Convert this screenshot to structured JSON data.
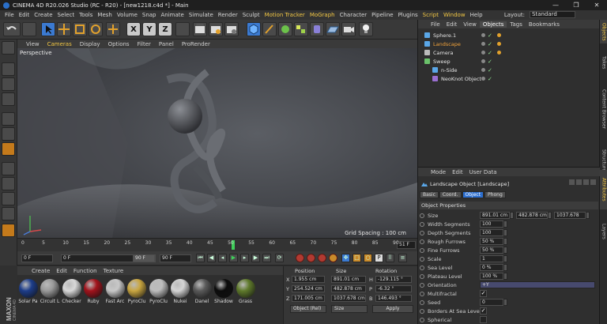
{
  "titlebar": {
    "title": "CINEMA 4D R20.026 Studio (RC - R20) - [new1218.c4d *] - Main",
    "minimize": "—",
    "maximize": "❐",
    "close": "✕"
  },
  "menubar": {
    "items": [
      "File",
      "Edit",
      "Create",
      "Select",
      "Tools",
      "Mesh",
      "Volume",
      "Snap",
      "Animate",
      "Simulate",
      "Render",
      "Sculpt",
      "Motion Tracker",
      "MoGraph",
      "Character",
      "Pipeline",
      "Plugins",
      "Script",
      "Window",
      "Help"
    ],
    "layout_label": "Layout:",
    "layout_value": "Standard"
  },
  "viewport": {
    "menu": [
      "View",
      "Cameras",
      "Display",
      "Options",
      "Filter",
      "Panel",
      "ProRender"
    ],
    "label": "Perspective",
    "grid_spacing": "Grid Spacing : 100 cm"
  },
  "timeline": {
    "ticks": [
      "0",
      "5",
      "10",
      "15",
      "20",
      "25",
      "30",
      "35",
      "40",
      "45",
      "50",
      "55",
      "60",
      "65",
      "70",
      "75",
      "80",
      "85",
      "90"
    ],
    "current_frame": 51,
    "frame_field": "51 F",
    "max_frame": 90
  },
  "transport": {
    "start": "0 F",
    "current": "0 F",
    "end_left": "90 F",
    "end_right": "90 F"
  },
  "material_manager": {
    "menu": [
      "Create",
      "Edit",
      "Function",
      "Texture"
    ],
    "materials": [
      {
        "name": "Solar Pa",
        "color": "#1d3d8a"
      },
      {
        "name": "Circuit L",
        "color": "#9a9a9a"
      },
      {
        "name": "Checker",
        "color": "#d8d8d8"
      },
      {
        "name": "Ruby",
        "color": "#a2131c"
      },
      {
        "name": "Fast Arc",
        "color": "#c8c8c8"
      },
      {
        "name": "PyroClu",
        "color": "#c9a640"
      },
      {
        "name": "PyroClu",
        "color": "#bdbdbd"
      },
      {
        "name": "Nukei",
        "color": "#d4d4d4"
      },
      {
        "name": "Danel",
        "color": "#5a5a5a"
      },
      {
        "name": "Shadow",
        "color": "#0c0c0c"
      },
      {
        "name": "Grass",
        "color": "#5f7a2b"
      }
    ]
  },
  "coordinates": {
    "headers": {
      "position": "Position",
      "size": "Size",
      "rotation": "Rotation"
    },
    "rows": [
      {
        "axis": "X",
        "pos": "1.955 cm",
        "size": "891.01 cm",
        "rot_axis": "H",
        "rot": "-129.115 °"
      },
      {
        "axis": "Y",
        "pos": "254.524 cm",
        "size": "482.878 cm",
        "rot_axis": "P",
        "rot": "-6.32 °"
      },
      {
        "axis": "Z",
        "pos": "171.005 cm",
        "size": "1037.678 cm",
        "rot_axis": "B",
        "rot": "146.493 °"
      }
    ],
    "mode": "Object (Rel)",
    "size_mode": "Size",
    "apply": "Apply"
  },
  "object_manager": {
    "menu": [
      "File",
      "Edit",
      "View",
      "Objects",
      "Tags",
      "Bookmarks"
    ],
    "active_menu": "Objects",
    "objects": [
      {
        "name": "Sphere.1",
        "color": "#5aa7e8",
        "indent": 0,
        "orange": false
      },
      {
        "name": "Landscape",
        "color": "#5aa7e8",
        "indent": 0,
        "orange": true
      },
      {
        "name": "Camera",
        "color": "#bbbbbb",
        "indent": 0,
        "orange": false
      },
      {
        "name": "Sweep",
        "color": "#6bc26b",
        "indent": 0,
        "orange": false
      },
      {
        "name": "n-Side",
        "color": "#5aa7e8",
        "indent": 1,
        "orange": false
      },
      {
        "name": "NeoKnot Object",
        "color": "#9a6fd1",
        "indent": 1,
        "orange": false
      }
    ]
  },
  "side_tabs": [
    "Objects",
    "Takes",
    "Content Browser",
    "Structure",
    "Attributes",
    "Layers"
  ],
  "attributes": {
    "menu": [
      "Mode",
      "Edit",
      "User Data"
    ],
    "title": "Landscape Object [Landscape]",
    "tabs": [
      "Basic",
      "Coord.",
      "Object",
      "Phong"
    ],
    "active_tab": "Object",
    "section": "Object Properties",
    "rows": [
      {
        "label": "Size",
        "values": [
          "891.01 cm",
          "482.878 cm",
          "1037.678"
        ]
      },
      {
        "label": "Width Segments",
        "values": [
          "100"
        ]
      },
      {
        "label": "Depth Segments",
        "values": [
          "100"
        ]
      },
      {
        "label": "Rough Furrows",
        "values": [
          "50 %"
        ]
      },
      {
        "label": "Fine Furrows",
        "values": [
          "50 %"
        ]
      },
      {
        "label": "Scale",
        "values": [
          "1"
        ]
      },
      {
        "label": "Sea Level",
        "values": [
          "0 %"
        ]
      },
      {
        "label": "Plateau Level",
        "values": [
          "100 %"
        ]
      },
      {
        "label": "Orientation",
        "values": [
          "+Y"
        ],
        "dropdown": true
      },
      {
        "label": "Multifractal",
        "values": [
          "✓"
        ],
        "check": true
      },
      {
        "label": "Seed",
        "values": [
          "0"
        ]
      },
      {
        "label": "Borders At Sea Level",
        "values": [
          "✓"
        ],
        "check": true
      },
      {
        "label": "Spherical",
        "values": [
          ""
        ],
        "check": true
      }
    ]
  },
  "brand": {
    "name": "MAXON",
    "product": "CINEMA 4D"
  }
}
